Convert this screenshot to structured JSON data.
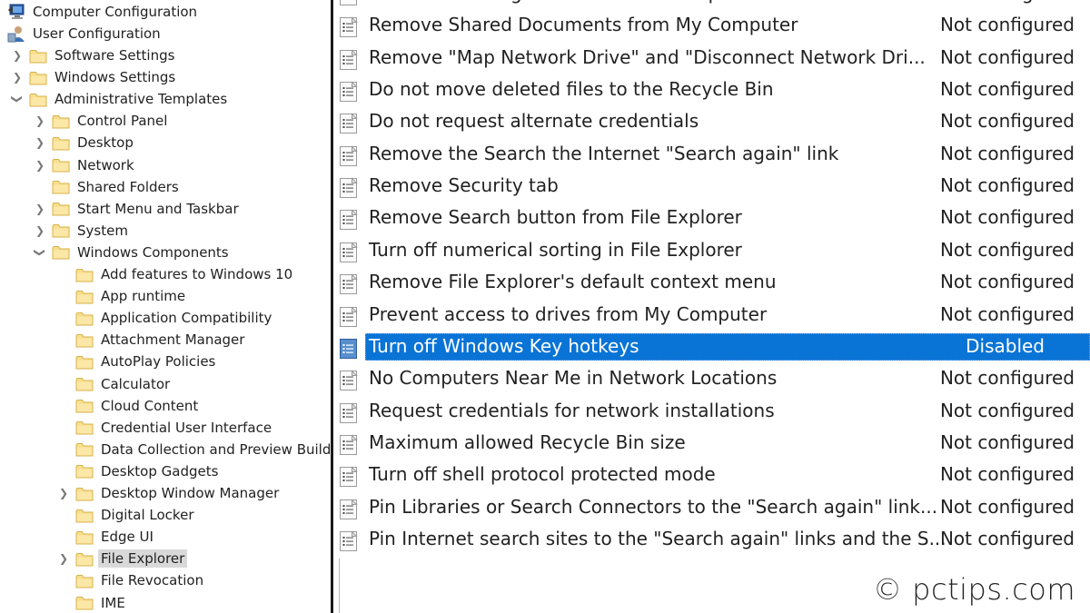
{
  "tree": {
    "roots": [
      {
        "label": "Computer Configuration",
        "icon": "computer-icon"
      },
      {
        "label": "User Configuration",
        "icon": "user-config-icon"
      }
    ],
    "items": [
      {
        "label": "Software Settings",
        "level": 1,
        "expander": "collapsed"
      },
      {
        "label": "Windows Settings",
        "level": 1,
        "expander": "collapsed"
      },
      {
        "label": "Administrative Templates",
        "level": 1,
        "expander": "expanded"
      },
      {
        "label": "Control Panel",
        "level": 2,
        "expander": "collapsed"
      },
      {
        "label": "Desktop",
        "level": 2,
        "expander": "collapsed"
      },
      {
        "label": "Network",
        "level": 2,
        "expander": "collapsed"
      },
      {
        "label": "Shared Folders",
        "level": 2,
        "expander": "none"
      },
      {
        "label": "Start Menu and Taskbar",
        "level": 2,
        "expander": "collapsed"
      },
      {
        "label": "System",
        "level": 2,
        "expander": "collapsed"
      },
      {
        "label": "Windows Components",
        "level": 2,
        "expander": "expanded"
      },
      {
        "label": "Add features to Windows 10",
        "level": 3,
        "expander": "none"
      },
      {
        "label": "App runtime",
        "level": 3,
        "expander": "none"
      },
      {
        "label": "Application Compatibility",
        "level": 3,
        "expander": "none"
      },
      {
        "label": "Attachment Manager",
        "level": 3,
        "expander": "none"
      },
      {
        "label": "AutoPlay Policies",
        "level": 3,
        "expander": "none"
      },
      {
        "label": "Calculator",
        "level": 3,
        "expander": "none"
      },
      {
        "label": "Cloud Content",
        "level": 3,
        "expander": "none"
      },
      {
        "label": "Credential User Interface",
        "level": 3,
        "expander": "none"
      },
      {
        "label": "Data Collection and Preview Builds",
        "level": 3,
        "expander": "none"
      },
      {
        "label": "Desktop Gadgets",
        "level": 3,
        "expander": "none"
      },
      {
        "label": "Desktop Window Manager",
        "level": 3,
        "expander": "collapsed"
      },
      {
        "label": "Digital Locker",
        "level": 3,
        "expander": "none"
      },
      {
        "label": "Edge UI",
        "level": 3,
        "expander": "none"
      },
      {
        "label": "File Explorer",
        "level": 3,
        "expander": "collapsed",
        "selected": true
      },
      {
        "label": "File Revocation",
        "level": 3,
        "expander": "none"
      },
      {
        "label": "IME",
        "level": 3,
        "expander": "none"
      }
    ]
  },
  "policies": [
    {
      "name": "Hides the Manage item on the File Explorer context menu",
      "state": "Not configured"
    },
    {
      "name": "Remove Shared Documents from My Computer",
      "state": "Not configured"
    },
    {
      "name": "Remove \"Map Network Drive\" and \"Disconnect Network Dri...",
      "state": "Not configured"
    },
    {
      "name": "Do not move deleted files to the Recycle Bin",
      "state": "Not configured"
    },
    {
      "name": "Do not request alternate credentials",
      "state": "Not configured"
    },
    {
      "name": "Remove the Search the Internet \"Search again\" link",
      "state": "Not configured"
    },
    {
      "name": "Remove Security tab",
      "state": "Not configured"
    },
    {
      "name": "Remove Search button from File Explorer",
      "state": "Not configured"
    },
    {
      "name": "Turn off numerical sorting in File Explorer",
      "state": "Not configured"
    },
    {
      "name": "Remove File Explorer's default context menu",
      "state": "Not configured"
    },
    {
      "name": "Prevent access to drives from My Computer",
      "state": "Not configured"
    },
    {
      "name": "Turn off Windows Key hotkeys",
      "state": "Disabled",
      "selected": true
    },
    {
      "name": "No Computers Near Me in Network Locations",
      "state": "Not configured"
    },
    {
      "name": "Request credentials for network installations",
      "state": "Not configured"
    },
    {
      "name": "Maximum allowed Recycle Bin size",
      "state": "Not configured"
    },
    {
      "name": "Turn off shell protocol protected mode",
      "state": "Not configured"
    },
    {
      "name": "Pin Libraries or Search Connectors to the \"Search again\" link...",
      "state": "Not configured"
    },
    {
      "name": "Pin Internet search sites to the \"Search again\" links and the S...",
      "state": "Not configured"
    }
  ],
  "colors": {
    "selection": "#0a74d6",
    "folder": "#f5d77e",
    "tree_selection": "#d9d9d9"
  },
  "watermark": "© pctips.com"
}
